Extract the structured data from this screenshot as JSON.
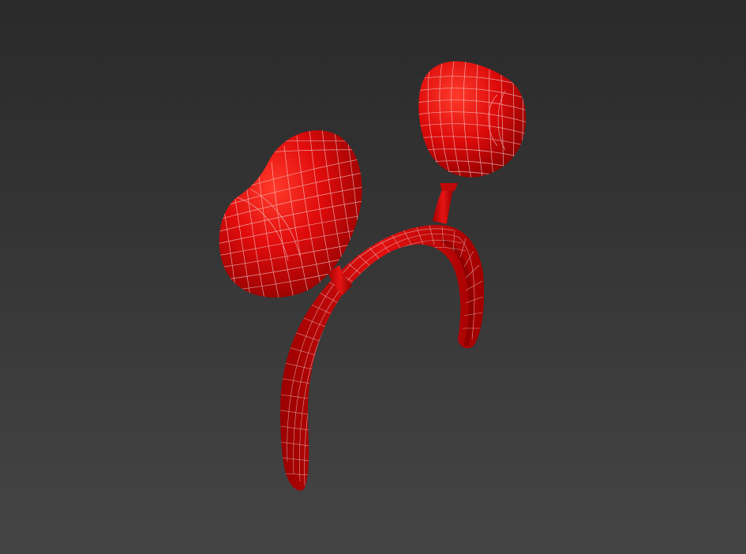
{
  "viewport": {
    "background_top": "#2a2a2a",
    "background_bottom": "#454545"
  },
  "model": {
    "subject_icon": "heart-headband-wireframe",
    "base_color": "#d40808",
    "highlight_color": "#ff3a2a",
    "shadow_color": "#7a0000",
    "wire_color": "#f2d6d6"
  }
}
